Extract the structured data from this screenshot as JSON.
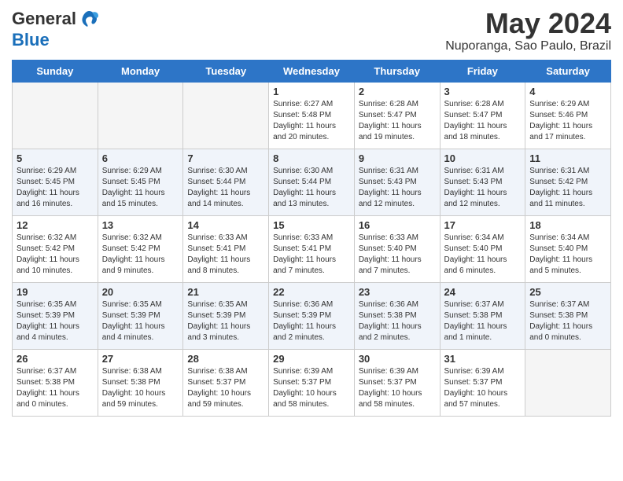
{
  "header": {
    "logo_general": "General",
    "logo_blue": "Blue",
    "month_title": "May 2024",
    "location": "Nuporanga, Sao Paulo, Brazil"
  },
  "days_of_week": [
    "Sunday",
    "Monday",
    "Tuesday",
    "Wednesday",
    "Thursday",
    "Friday",
    "Saturday"
  ],
  "weeks": [
    [
      {
        "day": null,
        "info": null
      },
      {
        "day": null,
        "info": null
      },
      {
        "day": null,
        "info": null
      },
      {
        "day": "1",
        "info": "Sunrise: 6:27 AM\nSunset: 5:48 PM\nDaylight: 11 hours and 20 minutes."
      },
      {
        "day": "2",
        "info": "Sunrise: 6:28 AM\nSunset: 5:47 PM\nDaylight: 11 hours and 19 minutes."
      },
      {
        "day": "3",
        "info": "Sunrise: 6:28 AM\nSunset: 5:47 PM\nDaylight: 11 hours and 18 minutes."
      },
      {
        "day": "4",
        "info": "Sunrise: 6:29 AM\nSunset: 5:46 PM\nDaylight: 11 hours and 17 minutes."
      }
    ],
    [
      {
        "day": "5",
        "info": "Sunrise: 6:29 AM\nSunset: 5:45 PM\nDaylight: 11 hours and 16 minutes."
      },
      {
        "day": "6",
        "info": "Sunrise: 6:29 AM\nSunset: 5:45 PM\nDaylight: 11 hours and 15 minutes."
      },
      {
        "day": "7",
        "info": "Sunrise: 6:30 AM\nSunset: 5:44 PM\nDaylight: 11 hours and 14 minutes."
      },
      {
        "day": "8",
        "info": "Sunrise: 6:30 AM\nSunset: 5:44 PM\nDaylight: 11 hours and 13 minutes."
      },
      {
        "day": "9",
        "info": "Sunrise: 6:31 AM\nSunset: 5:43 PM\nDaylight: 11 hours and 12 minutes."
      },
      {
        "day": "10",
        "info": "Sunrise: 6:31 AM\nSunset: 5:43 PM\nDaylight: 11 hours and 12 minutes."
      },
      {
        "day": "11",
        "info": "Sunrise: 6:31 AM\nSunset: 5:42 PM\nDaylight: 11 hours and 11 minutes."
      }
    ],
    [
      {
        "day": "12",
        "info": "Sunrise: 6:32 AM\nSunset: 5:42 PM\nDaylight: 11 hours and 10 minutes."
      },
      {
        "day": "13",
        "info": "Sunrise: 6:32 AM\nSunset: 5:42 PM\nDaylight: 11 hours and 9 minutes."
      },
      {
        "day": "14",
        "info": "Sunrise: 6:33 AM\nSunset: 5:41 PM\nDaylight: 11 hours and 8 minutes."
      },
      {
        "day": "15",
        "info": "Sunrise: 6:33 AM\nSunset: 5:41 PM\nDaylight: 11 hours and 7 minutes."
      },
      {
        "day": "16",
        "info": "Sunrise: 6:33 AM\nSunset: 5:40 PM\nDaylight: 11 hours and 7 minutes."
      },
      {
        "day": "17",
        "info": "Sunrise: 6:34 AM\nSunset: 5:40 PM\nDaylight: 11 hours and 6 minutes."
      },
      {
        "day": "18",
        "info": "Sunrise: 6:34 AM\nSunset: 5:40 PM\nDaylight: 11 hours and 5 minutes."
      }
    ],
    [
      {
        "day": "19",
        "info": "Sunrise: 6:35 AM\nSunset: 5:39 PM\nDaylight: 11 hours and 4 minutes."
      },
      {
        "day": "20",
        "info": "Sunrise: 6:35 AM\nSunset: 5:39 PM\nDaylight: 11 hours and 4 minutes."
      },
      {
        "day": "21",
        "info": "Sunrise: 6:35 AM\nSunset: 5:39 PM\nDaylight: 11 hours and 3 minutes."
      },
      {
        "day": "22",
        "info": "Sunrise: 6:36 AM\nSunset: 5:39 PM\nDaylight: 11 hours and 2 minutes."
      },
      {
        "day": "23",
        "info": "Sunrise: 6:36 AM\nSunset: 5:38 PM\nDaylight: 11 hours and 2 minutes."
      },
      {
        "day": "24",
        "info": "Sunrise: 6:37 AM\nSunset: 5:38 PM\nDaylight: 11 hours and 1 minute."
      },
      {
        "day": "25",
        "info": "Sunrise: 6:37 AM\nSunset: 5:38 PM\nDaylight: 11 hours and 0 minutes."
      }
    ],
    [
      {
        "day": "26",
        "info": "Sunrise: 6:37 AM\nSunset: 5:38 PM\nDaylight: 11 hours and 0 minutes."
      },
      {
        "day": "27",
        "info": "Sunrise: 6:38 AM\nSunset: 5:38 PM\nDaylight: 10 hours and 59 minutes."
      },
      {
        "day": "28",
        "info": "Sunrise: 6:38 AM\nSunset: 5:37 PM\nDaylight: 10 hours and 59 minutes."
      },
      {
        "day": "29",
        "info": "Sunrise: 6:39 AM\nSunset: 5:37 PM\nDaylight: 10 hours and 58 minutes."
      },
      {
        "day": "30",
        "info": "Sunrise: 6:39 AM\nSunset: 5:37 PM\nDaylight: 10 hours and 58 minutes."
      },
      {
        "day": "31",
        "info": "Sunrise: 6:39 AM\nSunset: 5:37 PM\nDaylight: 10 hours and 57 minutes."
      },
      {
        "day": null,
        "info": null
      }
    ]
  ]
}
